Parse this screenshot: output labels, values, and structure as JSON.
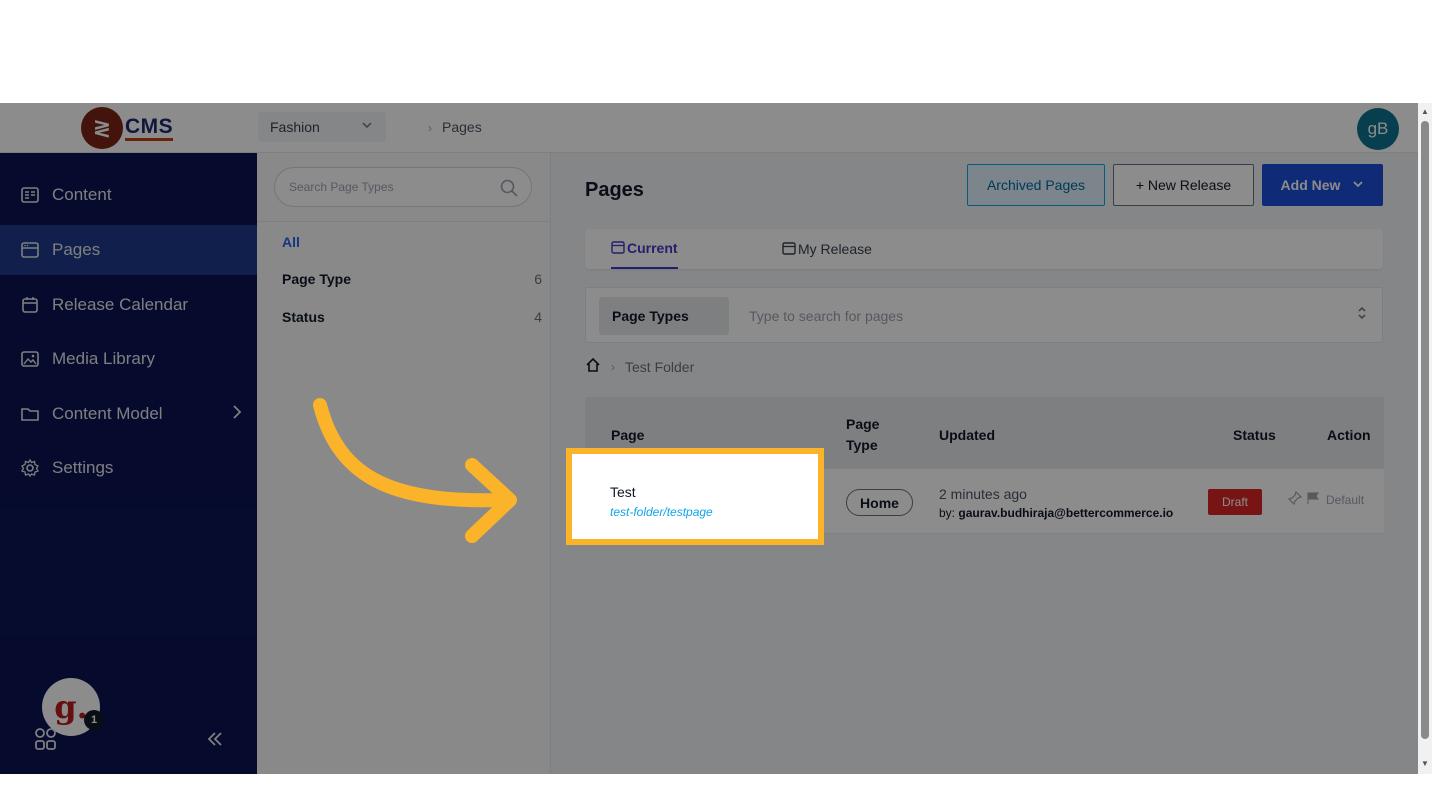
{
  "app": {
    "logo_text": "CMS",
    "avatar_initials": "gB"
  },
  "header": {
    "store": "Fashion",
    "breadcrumb": "Pages"
  },
  "sidebar": {
    "items": [
      {
        "label": "Content"
      },
      {
        "label": "Pages"
      },
      {
        "label": "Release Calendar"
      },
      {
        "label": "Media Library"
      },
      {
        "label": "Content Model"
      },
      {
        "label": "Settings"
      }
    ],
    "badge_letter": "g.",
    "badge_count": "1"
  },
  "filters": {
    "search_placeholder": "Search Page Types",
    "all": "All",
    "rows": [
      {
        "label": "Page Type",
        "count": "6"
      },
      {
        "label": "Status",
        "count": "4"
      }
    ]
  },
  "main": {
    "title": "Pages",
    "archived_label": "Archived Pages",
    "new_release_label": "+ New Release",
    "add_new_label": "Add New",
    "tabs": [
      {
        "label": "Current"
      },
      {
        "label": "My Release"
      }
    ],
    "page_types_chip": "Page Types",
    "search_placeholder": "Type to search for pages",
    "folder": "Test Folder",
    "columns": {
      "page": "Page",
      "page_type_1": "Page",
      "page_type_2": "Type",
      "updated": "Updated",
      "status": "Status",
      "action": "Action"
    },
    "row": {
      "name": "Test",
      "slug": "test-folder/testpage",
      "page_type": "Home",
      "updated": "2 minutes ago",
      "by_prefix": "by:",
      "by_user": "gaurav.budhiraja@bettercommerce.io",
      "status": "Draft",
      "action_default": "Default"
    }
  },
  "colors": {
    "highlight": "#fbb32a",
    "sidebar": "#0b1552",
    "primary": "#1d4ed8",
    "draft": "#dc2626"
  }
}
